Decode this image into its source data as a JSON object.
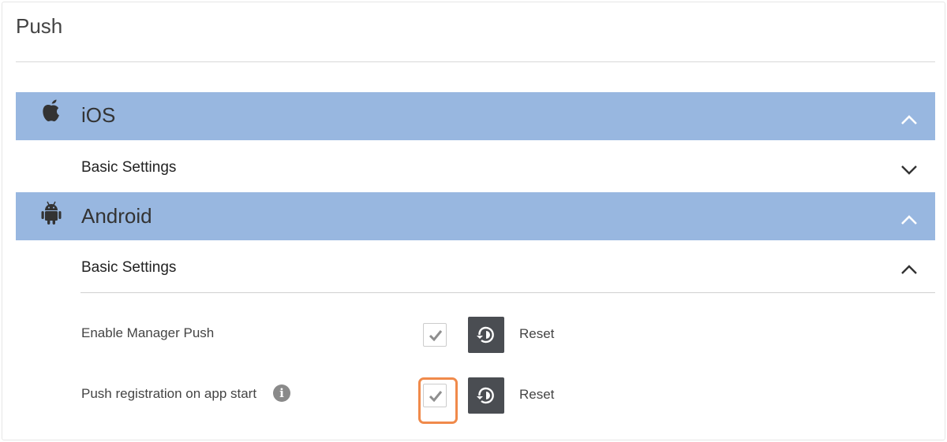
{
  "page": {
    "title": "Push"
  },
  "platforms": {
    "ios": {
      "label": "iOS",
      "icon": "apple-icon",
      "expanded": true,
      "section": {
        "label": "Basic Settings",
        "expanded": false
      }
    },
    "android": {
      "label": "Android",
      "icon": "android-icon",
      "expanded": true,
      "section": {
        "label": "Basic Settings",
        "expanded": true
      }
    }
  },
  "settings": [
    {
      "label": "Enable Manager Push",
      "checked": true,
      "reset_label": "Reset",
      "info": false
    },
    {
      "label": "Push registration on app start",
      "checked": true,
      "reset_label": "Reset",
      "info": true,
      "focused": true
    }
  ],
  "colors": {
    "platform_bar": "#98b7e0",
    "reset_button": "#4a4d52",
    "focus_ring": "#f08a4b",
    "checkmark": "#8f8f8f"
  }
}
